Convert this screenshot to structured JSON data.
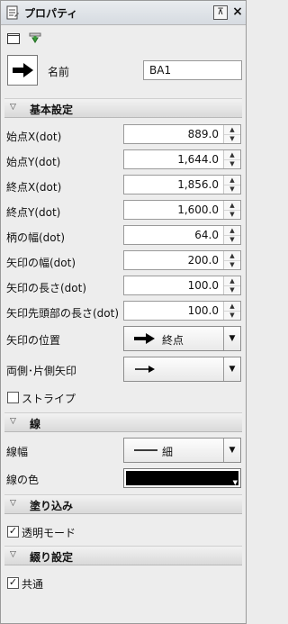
{
  "panel": {
    "title": "プロパティ",
    "pin_glyph": "⊼",
    "close_glyph": "×"
  },
  "object": {
    "name_label": "名前",
    "name_value": "BA1"
  },
  "sections": {
    "basic": "基本設定",
    "line": "線",
    "fill": "塗り込み",
    "binding": "綴り設定"
  },
  "basic": {
    "start_x": {
      "label": "始点X(dot)",
      "value": "889.0"
    },
    "start_y": {
      "label": "始点Y(dot)",
      "value": "1,644.0"
    },
    "end_x": {
      "label": "終点X(dot)",
      "value": "1,856.0"
    },
    "end_y": {
      "label": "終点Y(dot)",
      "value": "1,600.0"
    },
    "shaft_width": {
      "label": "柄の幅(dot)",
      "value": "64.0"
    },
    "arrow_width": {
      "label": "矢印の幅(dot)",
      "value": "200.0"
    },
    "arrow_length": {
      "label": "矢印の長さ(dot)",
      "value": "100.0"
    },
    "tip_length": {
      "label": "矢印先頭部の長さ(dot)",
      "value": "100.0"
    },
    "arrow_position": {
      "label": "矢印の位置",
      "value": "終点"
    },
    "arrow_direction": {
      "label": "両側･片側矢印",
      "value": ""
    },
    "stripe": {
      "label": "ストライプ",
      "checked": false
    }
  },
  "line": {
    "width_label": "線幅",
    "width_value": "細",
    "color_label": "線の色",
    "color_value": "#000000"
  },
  "fill": {
    "transparent": {
      "label": "透明モード",
      "checked": true
    }
  },
  "binding": {
    "common": {
      "label": "共通",
      "checked": true
    }
  },
  "icons": {
    "title": "properties-sheet-icon",
    "tool1": "blank-page-icon",
    "tool2": "download-arrow-icon",
    "shape": "arrow-shape-icon"
  }
}
